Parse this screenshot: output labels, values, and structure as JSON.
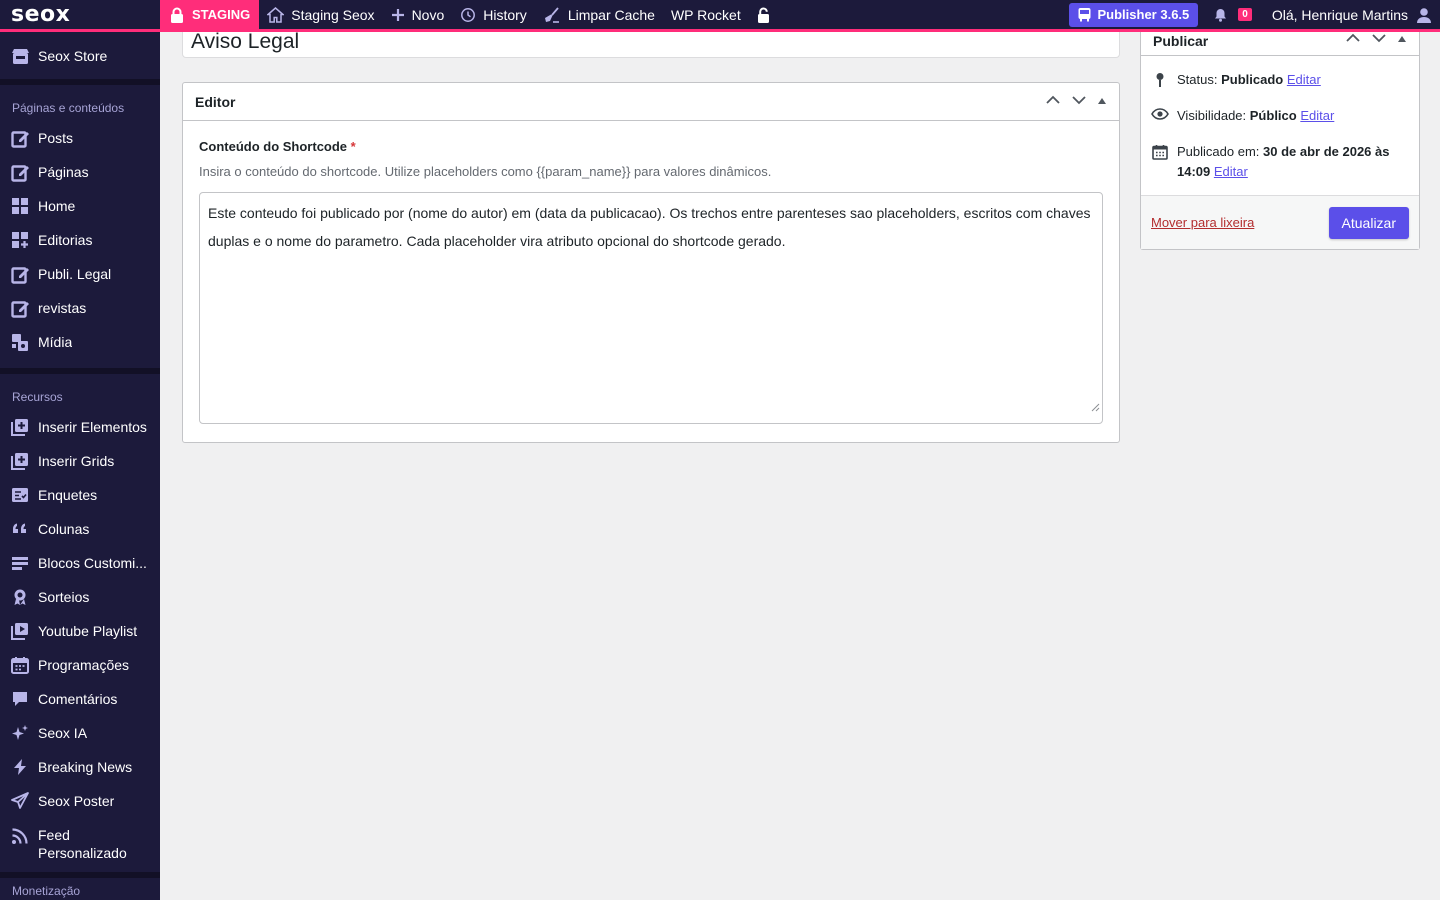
{
  "colors": {
    "admin_bg": "#1c1a3b",
    "accent_pink": "#ff2d7a",
    "accent_purple": "#5b4fe9"
  },
  "adminbar": {
    "logo": "seox",
    "staging": "STAGING",
    "items": [
      {
        "label": "Staging Seox",
        "icon": "home-icon"
      },
      {
        "label": "Novo",
        "icon": "plus-icon"
      },
      {
        "label": "History",
        "icon": "history-icon"
      },
      {
        "label": "Limpar Cache",
        "icon": "broom-icon"
      },
      {
        "label": "WP Rocket",
        "icon": ""
      }
    ],
    "publisher": "Publisher 3.6.5",
    "notifications": "0",
    "greeting": "Olá, Henrique Martins"
  },
  "sidebar": {
    "top_item": "Seox Store",
    "section1": "Páginas e conteúdos",
    "items1": [
      "Posts",
      "Páginas",
      "Home",
      "Editorias",
      "Publi. Legal",
      "revistas",
      "Mídia"
    ],
    "section2": "Recursos",
    "items2": [
      "Inserir Elementos",
      "Inserir Grids",
      "Enquetes",
      "Colunas",
      "Blocos Customi...",
      "Sorteios",
      "Youtube Playlist",
      "Programações",
      "Comentários",
      "Seox IA",
      "Breaking News",
      "Seox Poster",
      "Feed Personalizado"
    ],
    "section3": "Monetização"
  },
  "main": {
    "post_title": "Aviso Legal",
    "editor": {
      "title": "Editor",
      "field_label": "Conteúdo do Shortcode",
      "required_mark": "*",
      "field_desc": "Insira o conteúdo do shortcode. Utilize placeholders como {{param_name}} para valores dinâmicos.",
      "field_value": "Este conteudo foi publicado por (nome do autor) em (data da publicacao). Os trechos entre parenteses sao placeholders, escritos com chaves duplas e o nome do parametro. Cada placeholder vira atributo opcional do shortcode gerado."
    },
    "publish": {
      "title": "Publicar",
      "status_label": "Status:",
      "status_value": "Publicado",
      "visibility_label": "Visibilidade:",
      "visibility_value": "Público",
      "published_label": "Publicado em:",
      "published_value": "30 de abr de 2026 às 14:09",
      "edit": "Editar",
      "trash": "Mover para lixeira",
      "update": "Atualizar"
    }
  }
}
